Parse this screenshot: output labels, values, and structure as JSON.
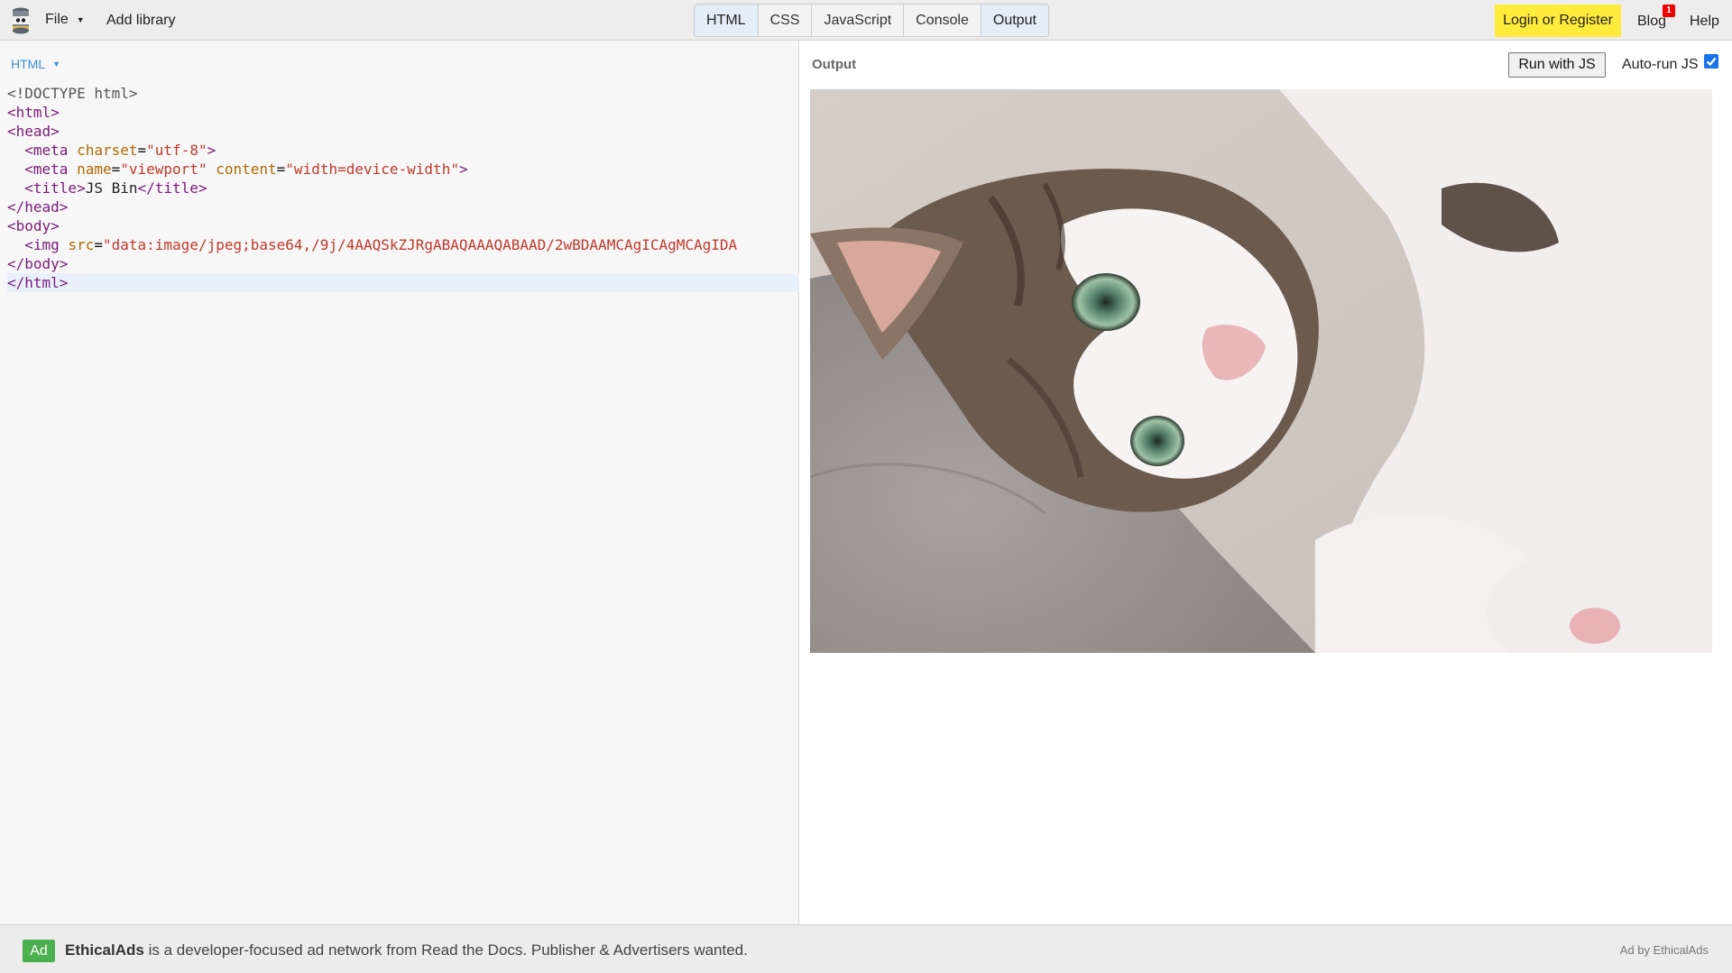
{
  "topbar": {
    "file_label": "File",
    "add_library_label": "Add library",
    "tabs": [
      {
        "label": "HTML",
        "active": true
      },
      {
        "label": "CSS",
        "active": false
      },
      {
        "label": "JavaScript",
        "active": false
      },
      {
        "label": "Console",
        "active": false
      },
      {
        "label": "Output",
        "active": true
      }
    ],
    "login_label": "Login or Register",
    "blog_label": "Blog",
    "blog_badge": "1",
    "help_label": "Help"
  },
  "editor": {
    "panel_label": "HTML",
    "lines": [
      "<!DOCTYPE html>",
      "<html>",
      "<head>",
      "  <meta charset=\"utf-8\">",
      "  <meta name=\"viewport\" content=\"width=device-width\">",
      "  <title>JS Bin</title>",
      "</head>",
      "<body>",
      "  <img src=\"data:image/jpeg;base64,/9j/4AAQSkZJRgABAQAAAQABAAD/2wBDAAMCAgICAgMCAgIDA",
      "</body>",
      "</html>"
    ],
    "current_line": 10
  },
  "output": {
    "panel_label": "Output",
    "run_button_label": "Run with JS",
    "autorun_label": "Auto-run JS",
    "autorun_checked": true
  },
  "ad": {
    "badge": "Ad",
    "brand": "EthicalAds",
    "text": " is a developer-focused ad network from Read the Docs. Publisher & Advertisers wanted.",
    "by_label": "Ad by EthicalAds"
  },
  "colors": {
    "accent_blue": "#3a8bd8",
    "login_yellow": "#ffeb3b",
    "ad_green": "#4caf50",
    "badge_red": "#ee0000"
  }
}
